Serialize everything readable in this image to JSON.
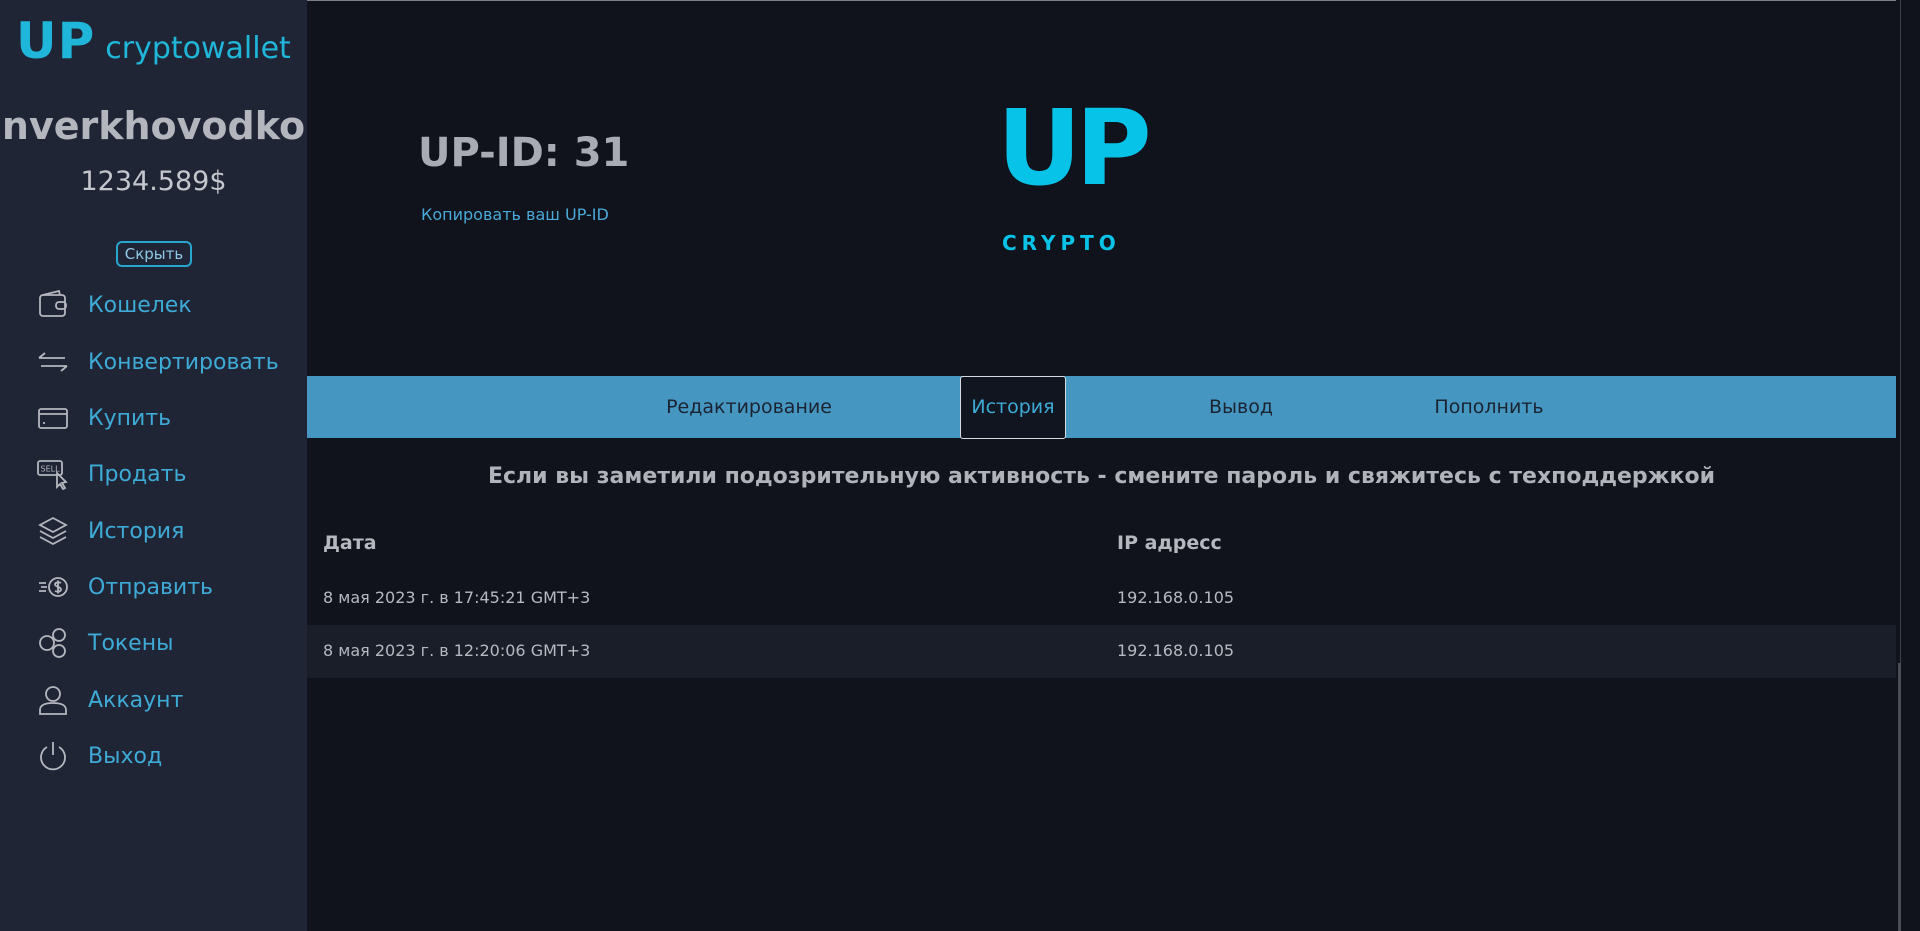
{
  "brand": {
    "up": "UP",
    "name": "cryptowallet"
  },
  "user": {
    "name": "nverkhovodko",
    "balance": "1234.589$",
    "hide_label": "Скрыть"
  },
  "sidebar": {
    "items": [
      {
        "label": "Кошелек",
        "icon": "wallet-icon"
      },
      {
        "label": "Конвертировать",
        "icon": "convert-arrows-icon"
      },
      {
        "label": "Купить",
        "icon": "credit-card-icon"
      },
      {
        "label": "Продать",
        "icon": "sell-icon"
      },
      {
        "label": "История",
        "icon": "layers-icon"
      },
      {
        "label": "Отправить",
        "icon": "send-money-icon"
      },
      {
        "label": "Токены",
        "icon": "tokens-icon"
      },
      {
        "label": "Аккаунт",
        "icon": "user-icon"
      },
      {
        "label": "Выход",
        "icon": "power-icon"
      }
    ]
  },
  "header": {
    "upid": "UP-ID: 31",
    "copy_link": "Копировать ваш UP-ID",
    "logo_up": "UP",
    "logo_crypto": "CRYPTO"
  },
  "tabs": [
    {
      "label": "Редактирование",
      "active": false
    },
    {
      "label": "История",
      "active": true
    },
    {
      "label": "Вывод",
      "active": false
    },
    {
      "label": "Пополнить",
      "active": false
    }
  ],
  "notice": "Если вы заметили подозрительную активность - смените пароль и свяжитесь с техподдержкой",
  "table": {
    "headers": [
      "Дата",
      "IP адресс"
    ],
    "rows": [
      [
        "8 мая 2023 г. в 17:45:21 GMT+3",
        "192.168.0.105"
      ],
      [
        "8 мая 2023 г. в 12:20:06 GMT+3",
        "192.168.0.105"
      ]
    ]
  },
  "colors": {
    "accent": "#3eaad6",
    "tabbar": "#4597c2",
    "logo": "#08c3e8",
    "sidebar_bg": "#202536",
    "main_bg": "#10131b"
  }
}
